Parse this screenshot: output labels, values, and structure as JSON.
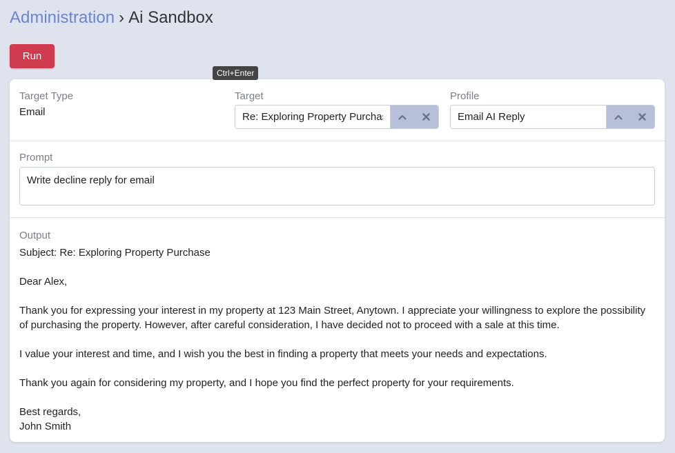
{
  "breadcrumb": {
    "parent": "Administration",
    "separator": "›",
    "current": "Ai Sandbox"
  },
  "toolbar": {
    "run_label": "Run",
    "run_tooltip": "Ctrl+Enter"
  },
  "fields": {
    "target_type": {
      "label": "Target Type",
      "value": "Email"
    },
    "target": {
      "label": "Target",
      "value": "Re: Exploring Property Purchase"
    },
    "profile": {
      "label": "Profile",
      "value": "Email AI Reply"
    }
  },
  "prompt": {
    "label": "Prompt",
    "value": "Write decline reply for email"
  },
  "output": {
    "label": "Output",
    "subject": "Subject: Re: Exploring Property Purchase",
    "greeting": "Dear Alex,",
    "paragraph1": "Thank you for expressing your interest in my property at 123 Main Street, Anytown. I appreciate your willingness to explore the possibility of purchasing the property. However, after careful consideration, I have decided not to proceed with a sale at this time.",
    "paragraph2": "I value your interest and time, and I wish you the best in finding a property that meets your needs and expectations.",
    "paragraph3": "Thank you again for considering my property, and I hope you find the perfect property for your requirements.",
    "closing": "Best regards,",
    "signature": "John Smith"
  },
  "icons": {
    "expand": "chevron-up-icon",
    "clear": "close-icon"
  },
  "colors": {
    "background": "#dfe3ee",
    "breadcrumb_link": "#6a85cf",
    "run_button": "#cf3b4f",
    "combo_buttons": "#b8c0d9"
  }
}
